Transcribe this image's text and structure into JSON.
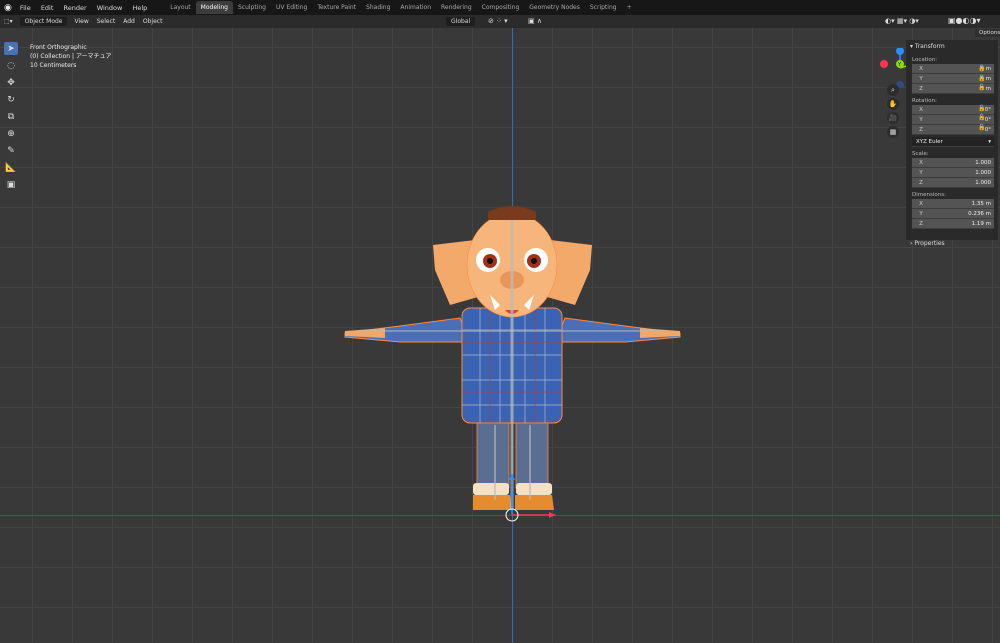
{
  "topbar": {
    "menu": [
      "File",
      "Edit",
      "Render",
      "Window",
      "Help"
    ],
    "workspaces": [
      "Layout",
      "Modeling",
      "Sculpting",
      "UV Editing",
      "Texture Paint",
      "Shading",
      "Animation",
      "Rendering",
      "Compositing",
      "Geometry Nodes",
      "Scripting"
    ],
    "active_workspace": "Modeling",
    "add_tab": "+"
  },
  "header": {
    "mode": "Object Mode",
    "menus": [
      "View",
      "Select",
      "Add",
      "Object"
    ],
    "orientation": "Global",
    "options_label": "Options"
  },
  "overlay": {
    "view_name": "Front Orthographic",
    "collection": "(0) Collection | アーマチュア",
    "scale": "10 Centimeters"
  },
  "gizmo": {
    "x_label": "X",
    "y_label": "Y",
    "z_label": "Z"
  },
  "npanel": {
    "transform_title": "Transform",
    "location_label": "Location:",
    "location": [
      {
        "axis": "X",
        "value": "0 m"
      },
      {
        "axis": "Y",
        "value": "0 m"
      },
      {
        "axis": "Z",
        "value": "0 m"
      }
    ],
    "rotation_label": "Rotation:",
    "rotation": [
      {
        "axis": "X",
        "value": "0°"
      },
      {
        "axis": "Y",
        "value": "0°"
      },
      {
        "axis": "Z",
        "value": "0°"
      }
    ],
    "rotation_mode": "XYZ Euler",
    "scale_label": "Scale:",
    "scale": [
      {
        "axis": "X",
        "value": "1.000"
      },
      {
        "axis": "Y",
        "value": "1.000"
      },
      {
        "axis": "Z",
        "value": "1.000"
      }
    ],
    "dimensions_label": "Dimensions:",
    "dimensions": [
      {
        "axis": "X",
        "value": "1.35 m"
      },
      {
        "axis": "Y",
        "value": "0.236 m"
      },
      {
        "axis": "Z",
        "value": "1.19 m"
      }
    ],
    "properties_label": "Properties"
  },
  "colors": {
    "accent": "#4772b3",
    "x_axis": "#ff3352",
    "y_axis": "#8bdc00",
    "z_axis": "#2890ff"
  }
}
